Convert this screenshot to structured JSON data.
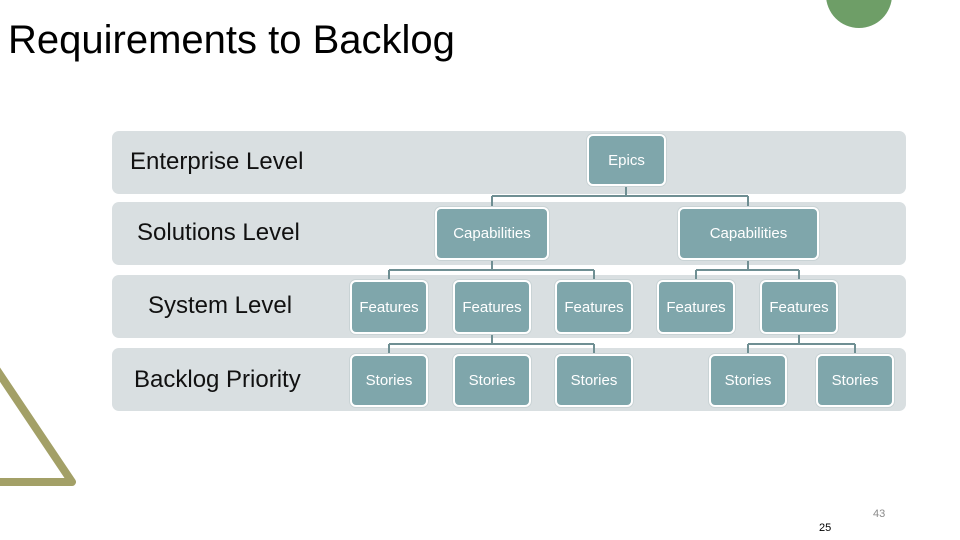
{
  "slide": {
    "title": "Requirements to Backlog",
    "page_number_secondary": "43",
    "page_number": "25",
    "colors": {
      "band": "#d9dfe1",
      "node": "#7fa6ab",
      "connector": "#6f8f93",
      "accent_circle": "#6e9e67",
      "accent_triangle": "#a3a067"
    }
  },
  "levels": [
    {
      "label": "Enterprise Level"
    },
    {
      "label": "Solutions Level"
    },
    {
      "label": "System Level"
    },
    {
      "label": "Backlog Priority"
    }
  ],
  "hierarchy": {
    "epics": {
      "label": "Epics"
    },
    "capabilities": [
      {
        "label": "Capabilities",
        "parent": "Epics"
      },
      {
        "label": "Capabilities",
        "parent": "Epics"
      }
    ],
    "features": [
      {
        "label": "Features",
        "parent_capability": 0
      },
      {
        "label": "Features",
        "parent_capability": 0
      },
      {
        "label": "Features",
        "parent_capability": 0
      },
      {
        "label": "Features",
        "parent_capability": 1
      },
      {
        "label": "Features",
        "parent_capability": 1
      }
    ],
    "stories": [
      {
        "label": "Stories",
        "parent_feature": 1
      },
      {
        "label": "Stories",
        "parent_feature": 1
      },
      {
        "label": "Stories",
        "parent_feature": 1
      },
      {
        "label": "Stories",
        "parent_feature": 4
      },
      {
        "label": "Stories",
        "parent_feature": 4
      }
    ]
  }
}
